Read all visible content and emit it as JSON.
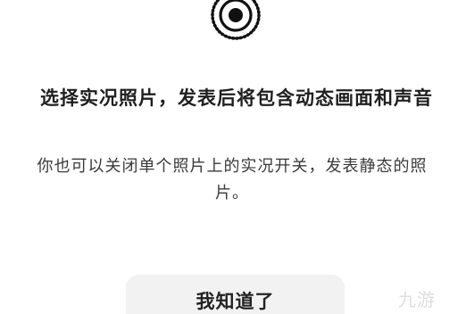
{
  "dialog": {
    "icon": "live-photo-icon",
    "title": "选择实况照片，发表后将包含动态画面和声音",
    "description": "你也可以关闭单个照片上的实况开关，发表静态的照片。",
    "confirm_label": "我知道了"
  },
  "watermark": {
    "text": "九游"
  },
  "colors": {
    "background": "#ffffff",
    "title_text": "#1f1f1f",
    "body_text": "#3a3a3a",
    "button_background": "#f2f2f2",
    "icon": "#111111"
  }
}
